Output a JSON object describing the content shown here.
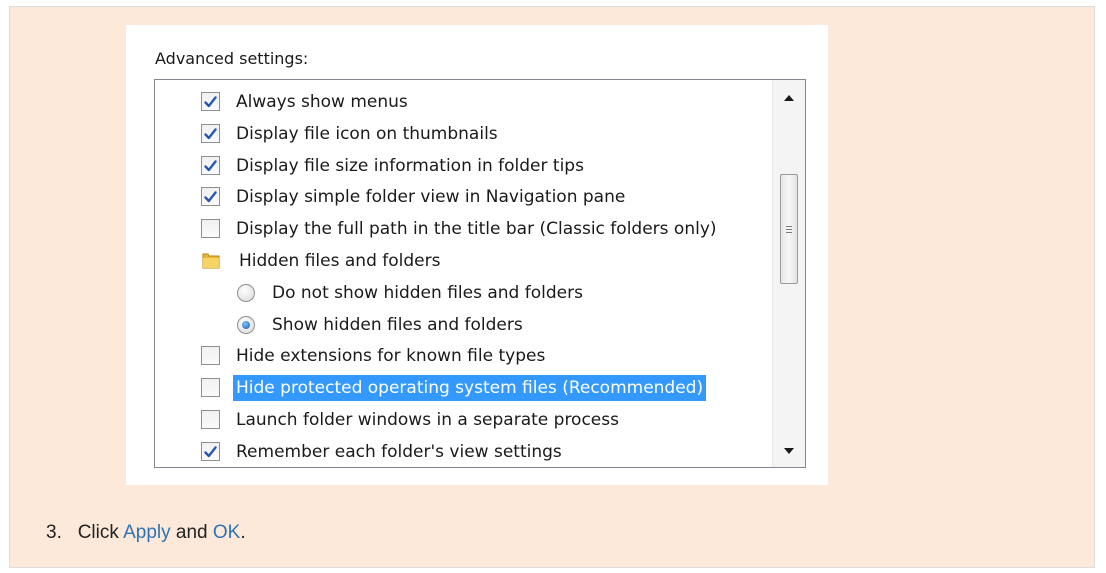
{
  "panel": {
    "heading": "Advanced settings:"
  },
  "settings_list": {
    "items": [
      {
        "type": "checkbox",
        "label": "Always show menus",
        "checked": true
      },
      {
        "type": "checkbox",
        "label": "Display file icon on thumbnails",
        "checked": true
      },
      {
        "type": "checkbox",
        "label": "Display file size information in folder tips",
        "checked": true
      },
      {
        "type": "checkbox",
        "label": "Display simple folder view in Navigation pane",
        "checked": true
      },
      {
        "type": "checkbox",
        "label": "Display the full path in the title bar (Classic folders only)",
        "checked": false
      },
      {
        "type": "folder",
        "label": "Hidden files and folders",
        "icon": "folder-icon"
      },
      {
        "type": "radio",
        "label": "Do not show hidden files and folders",
        "checked": false
      },
      {
        "type": "radio",
        "label": "Show hidden files and folders",
        "checked": true
      },
      {
        "type": "checkbox",
        "label": "Hide extensions for known file types",
        "checked": false
      },
      {
        "type": "checkbox",
        "label": "Hide protected operating system files (Recommended)",
        "checked": false,
        "selected": true
      },
      {
        "type": "checkbox",
        "label": "Launch folder windows in a separate process",
        "checked": false
      },
      {
        "type": "checkbox",
        "label": "Remember each folder's view settings",
        "checked": true
      }
    ]
  },
  "instruction": {
    "number": "3.",
    "prefix": "Click",
    "link1": "Apply",
    "middle": "and",
    "link2": "OK",
    "suffix": "."
  },
  "colors": {
    "page_background": "#fde9d9",
    "selection": "#3399ff",
    "link": "#2e74b5",
    "check_mark": "#2a56b0"
  }
}
